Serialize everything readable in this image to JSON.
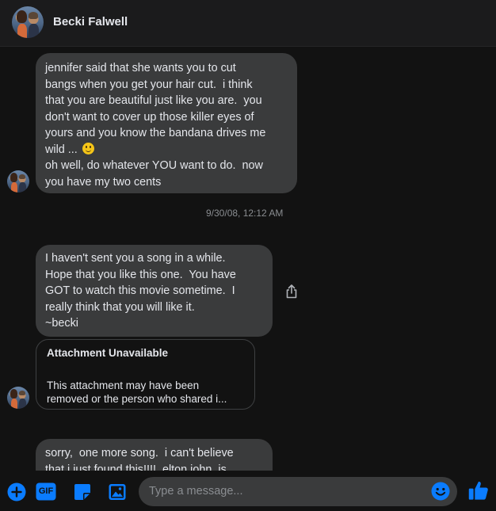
{
  "header": {
    "contact_name": "Becki Falwell"
  },
  "messages": [
    {
      "lines": [
        "jennifer said that she wants you to cut",
        "bangs when you get your hair cut.  i think",
        "that you are beautiful just like you are.  you",
        "don't want to cover up those killer eyes of",
        "yours and you know the bandana drives me",
        "wild ... ",
        "oh well, do whatever YOU want to do.  now",
        "you have my two cents"
      ],
      "emoji": "smiling-face"
    },
    {
      "lines": [
        "I haven't sent you a song in a while.",
        "Hope that you like this one.  You have",
        "GOT to watch this movie sometime.  I",
        "really think that you will like it.",
        "~becki"
      ]
    },
    {
      "lines": [
        "sorry,  one more song.  i can't believe",
        "that i just found this!!!!  elton john  is"
      ]
    }
  ],
  "timestamp": "9/30/08, 12:12 AM",
  "attachment": {
    "title": "Attachment Unavailable",
    "description_lines": [
      "This attachment may have been",
      "removed or the person who shared i..."
    ]
  },
  "composer": {
    "placeholder": "Type a message...",
    "gif_label": "GIF",
    "icons": [
      "add-icon",
      "gif-icon",
      "sticker-icon",
      "image-icon",
      "emoji-icon",
      "like-icon"
    ]
  },
  "colors": {
    "accent": "#0a7cff",
    "bubble": "#3a3b3c",
    "background": "#121212"
  }
}
